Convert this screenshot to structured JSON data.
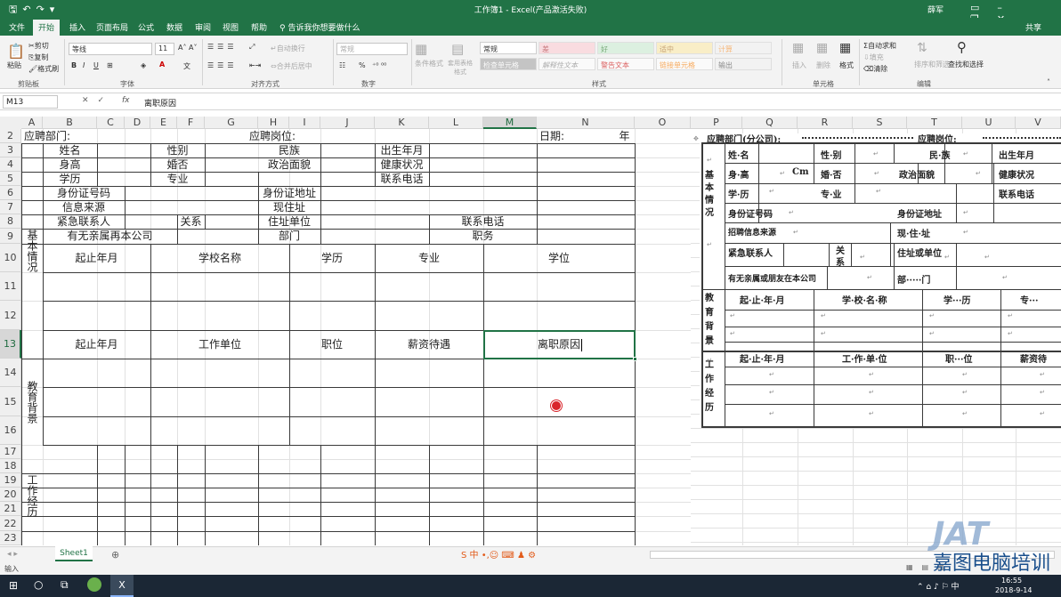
{
  "window": {
    "title": "工作簿1 - Excel(产品激活失败)",
    "user": "薛军"
  },
  "menu": [
    "文件",
    "开始",
    "插入",
    "页面布局",
    "公式",
    "数据",
    "审阅",
    "视图",
    "帮助"
  ],
  "tell_me": "告诉我你想要做什么",
  "share": "共享",
  "ribbon": {
    "clipboard": {
      "paste": "粘贴",
      "cut": "剪切",
      "copy": "复制",
      "format_painter": "格式刷",
      "label": "剪贴板"
    },
    "font": {
      "name": "等线",
      "size": "11",
      "bold": "B",
      "italic": "I",
      "underline": "U",
      "label": "字体"
    },
    "align": {
      "wrap": "自动换行",
      "merge": "合并后居中",
      "label": "对齐方式"
    },
    "number": {
      "format": "常规",
      "percent": "%",
      "label": "数字"
    },
    "styles": {
      "cond": "条件格式",
      "table": "套用表格格式",
      "items": [
        "常规",
        "差",
        "好",
        "适中",
        "计算",
        "检查单元格",
        "解释性文本",
        "警告文本",
        "链接单元格",
        "输出"
      ],
      "label": "样式"
    },
    "cells": {
      "insert": "插入",
      "delete": "删除",
      "format": "格式",
      "label": "单元格"
    },
    "editing": {
      "autosum": "自动求和",
      "fill": "填充",
      "clear": "清除",
      "sort": "排序和筛选",
      "find": "查找和选择",
      "label": "编辑"
    }
  },
  "formula_bar": {
    "name_box": "M13",
    "fx": "fx",
    "value": "离职原因"
  },
  "columns": [
    "A",
    "B",
    "C",
    "D",
    "E",
    "F",
    "G",
    "H",
    "I",
    "J",
    "K",
    "L",
    "M",
    "N",
    "O"
  ],
  "rows": [
    "2",
    "3",
    "4",
    "5",
    "6",
    "7",
    "8",
    "9",
    "10",
    "11",
    "12",
    "13",
    "14",
    "15",
    "16",
    "17",
    "18",
    "19",
    "20",
    "21",
    "22",
    "23"
  ],
  "form": {
    "dept": "应聘部门:",
    "pos": "应聘岗位:",
    "date": "日期:",
    "year": "年",
    "basic": "基本情况",
    "name": "姓名",
    "sex": "性别",
    "nation": "民族",
    "birth": "出生年月",
    "height": "身高",
    "marriage": "婚否",
    "political": "政治面貌",
    "health": "健康状况",
    "education": "学历",
    "major": "专业",
    "phone": "联系电话",
    "idno": "身份证号码",
    "idaddr": "身份证地址",
    "source": "信息来源",
    "curaddr": "现住址",
    "emergency": "紧急联系人",
    "relation": "关系",
    "workaddr": "住址单位",
    "phone2": "联系电话",
    "relatives": "有无亲属再本公司",
    "dept2": "部门",
    "duty": "职务",
    "edu_bg": "教育背景",
    "period": "起止年月",
    "school": "学校名称",
    "degree_h": "学历",
    "major_h": "专业",
    "degree": "学位",
    "work": "工作经历",
    "period2": "起止年月",
    "unit": "工作单位",
    "position": "职位",
    "salary": "薪资待遇",
    "reason": "离职原因"
  },
  "print_columns": [
    "P",
    "Q",
    "R",
    "S",
    "T",
    "U",
    "V"
  ],
  "print_form": {
    "header": "应聘部门(分公司):",
    "header2": "应聘岗位:",
    "basic": "基本情况",
    "name": "姓·名",
    "sex": "性·别",
    "nation": "民·族",
    "birth": "出生年月",
    "height": "身·高",
    "cm": "Cm",
    "marriage": "婚·否",
    "political": "政治面貌",
    "health": "健康状况",
    "edu": "学·历",
    "major": "专·业",
    "phone": "联系电话",
    "idno": "身份证号码",
    "idaddr": "身份证地址",
    "source": "招聘信息来源",
    "curaddr": "现·住·址",
    "emergency": "紧急联系人",
    "relation": "关系",
    "unit": "住址或单位",
    "relatives": "有无亲属或朋友在本公司",
    "dept": "部·····门",
    "edu_bg": "教育背景",
    "period": "起·止·年·月",
    "school": "学·校·名·称",
    "degree": "学···历",
    "major2": "专···",
    "work": "工作经历",
    "period2": "起·止·年·月",
    "wunit": "工·作·单·位",
    "wpos": "职···位",
    "salary": "薪资待",
    "para": "↵"
  },
  "sheet_tab": "Sheet1",
  "status": "输入",
  "taskbar": {
    "time": "16:55",
    "date": "2018-9-14"
  },
  "watermark": {
    "logo": "JAT",
    "text": "嘉图电脑培训"
  }
}
